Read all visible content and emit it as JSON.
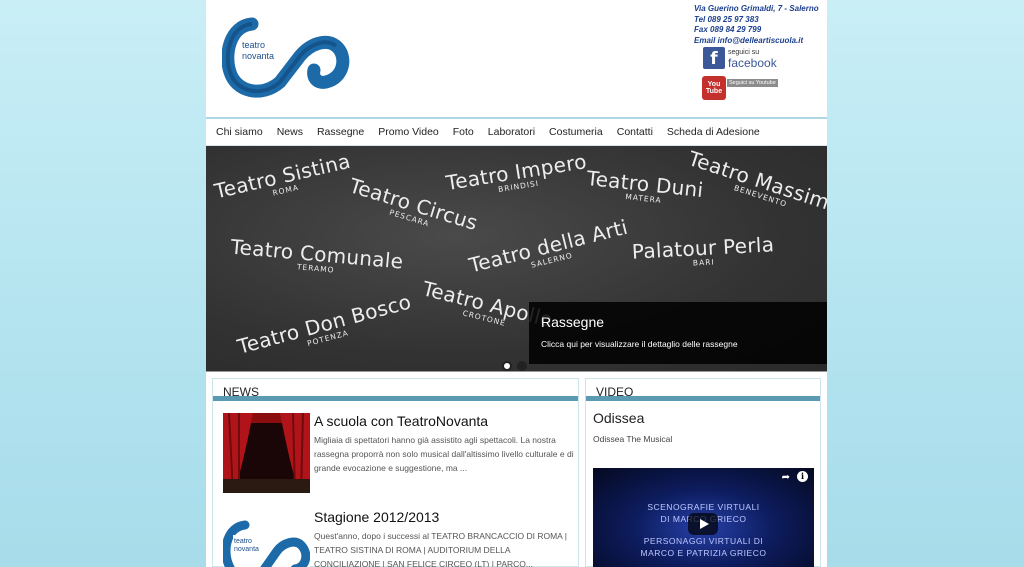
{
  "header": {
    "logo_text": "teatro novanta",
    "contact": {
      "address": "Via Guerino Grimaldi, 7 - Salerno",
      "tel": "Tel   089 25 97 383",
      "fax": "Fax  089 84 29 799",
      "email": "Email info@delleartiscuola.it"
    },
    "facebook": {
      "icon": "facebook-icon",
      "line1": "seguici su",
      "line2": "facebook"
    },
    "youtube": {
      "icon": "youtube-icon",
      "icon_text": "You Tube",
      "tag": "Seguici su Youtube"
    }
  },
  "nav": [
    "Chi siamo",
    "News",
    "Rassegne",
    "Promo Video",
    "Foto",
    "Laboratori",
    "Costumeria",
    "Contatti",
    "Scheda di Adesione"
  ],
  "slider": {
    "theatres": [
      {
        "name": "Teatro Sistina",
        "city": "ROMA"
      },
      {
        "name": "Teatro Circus",
        "city": "PESCARA"
      },
      {
        "name": "Teatro Impero",
        "city": "BRINDISI"
      },
      {
        "name": "Teatro Duni",
        "city": "MATERA"
      },
      {
        "name": "Teatro Massimo",
        "city": "BENEVENTO"
      },
      {
        "name": "Teatro Comunale",
        "city": "TERAMO"
      },
      {
        "name": "Teatro della Arti",
        "city": "SALERNO"
      },
      {
        "name": "Palatour Perla",
        "city": "BARI"
      },
      {
        "name": "Teatro Apollo",
        "city": "CROTONE"
      },
      {
        "name": "Teatro Don Bosco",
        "city": "POTENZA"
      }
    ],
    "caption_title": "Rassegne",
    "caption_text": "Clicca qui per visualizzare il dettaglio delle rassegne",
    "slide_count": 2,
    "active_slide": 2
  },
  "news": {
    "title": "NEWS",
    "items": [
      {
        "title": "A scuola con TeatroNovanta",
        "text": "Migliaia di spettatori hanno già assistito agli spettacoli. La nostra rassegna proporrà non solo musical dall'altissimo livello culturale e di grande evocazione e suggestione, ma ..."
      },
      {
        "title": "Stagione 2012/2013",
        "text": "Quest'anno, dopo i successi al TEATRO BRANCACCIO DI ROMA | TEATRO SISTINA DI ROMA | AUDITORIUM DELLA CONCILIAZIONE | SAN FELICE CIRCEO (LT) | PARCO..."
      }
    ]
  },
  "video": {
    "title": "VIDEO",
    "video_title": "Odissea",
    "video_subtitle": "Odissea The Musical",
    "player_line1": "SCENOGRAFIE VIRTUALI",
    "player_line2": "DI MARCO GRIECO",
    "player_line3": "PERSONAGGI VIRTUALI DI",
    "player_line4": "MARCO E PATRIZIA GRIECO"
  },
  "colors": {
    "background": "#b8e6f1",
    "accent_bar": "#5b9ab3",
    "contact_text": "#1b3f8f"
  }
}
